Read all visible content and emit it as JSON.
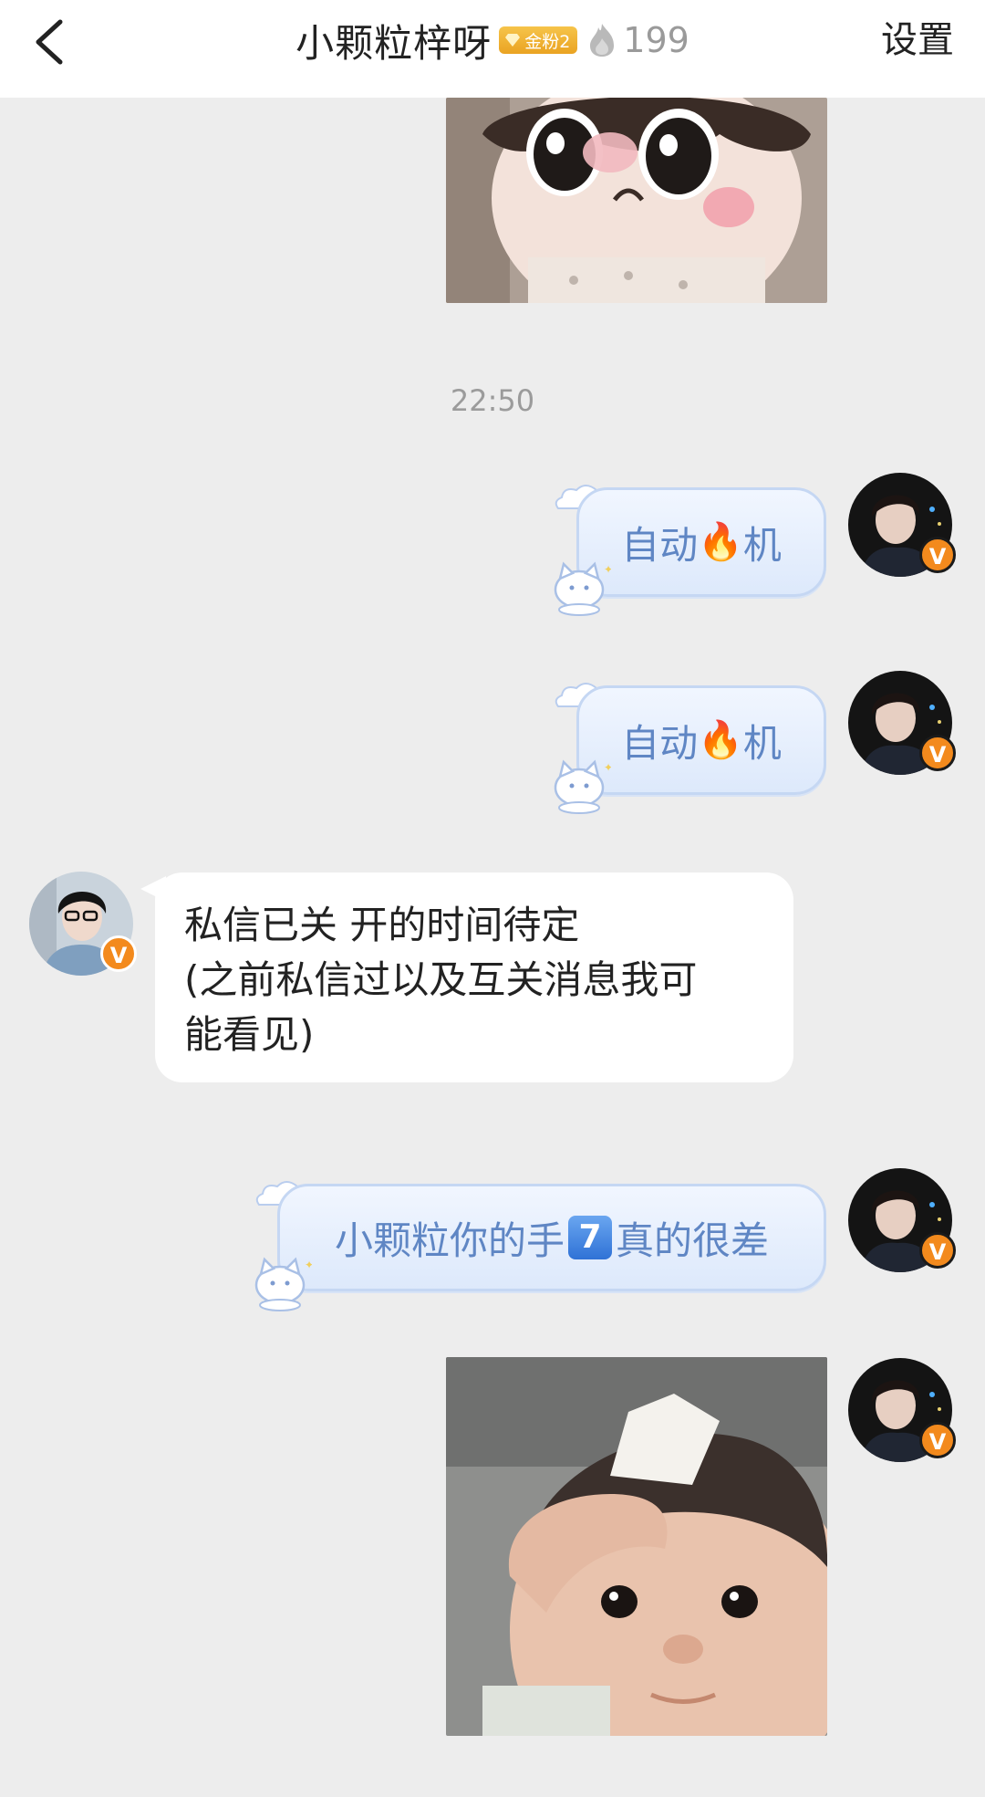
{
  "header": {
    "title": "小颗粒梓呀",
    "fan_badge": "金粉2",
    "fire_count": "199",
    "settings_label": "设置"
  },
  "chat": {
    "timestamp": "22:50",
    "messages": [
      {
        "sender": "me",
        "text_before": "自动",
        "emoji": "🔥",
        "text_after": "机"
      },
      {
        "sender": "me",
        "text_before": "自动",
        "emoji": "🔥",
        "text_after": "机"
      },
      {
        "sender": "them",
        "lines": [
          "私信已关 开的时间待定",
          "(之前私信过以及互关消息我可",
          "能看见)"
        ]
      },
      {
        "sender": "me",
        "text_before": "小颗粒你的手",
        "keycap": "7",
        "text_after": "真的很差"
      }
    ]
  }
}
